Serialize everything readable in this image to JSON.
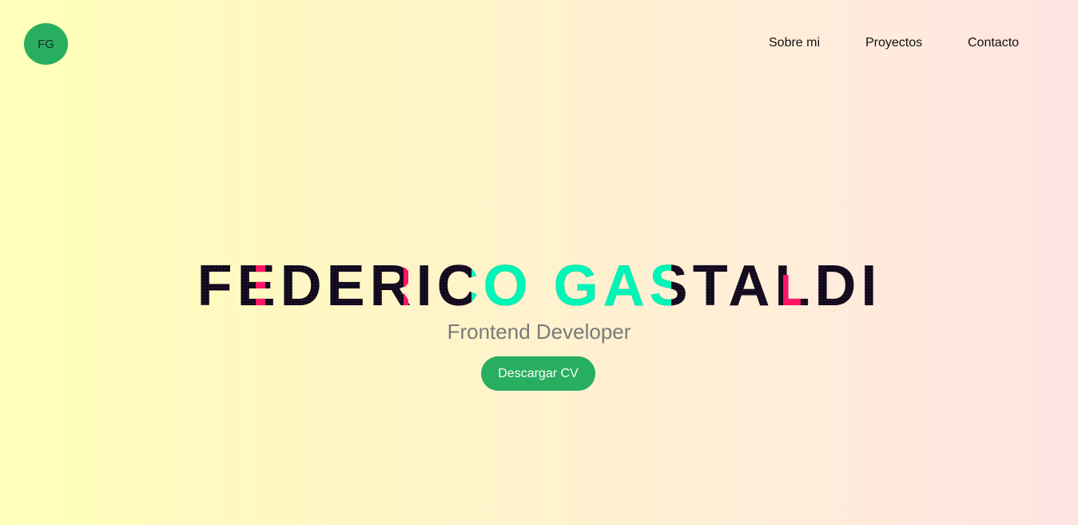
{
  "logo": {
    "initials": "FG"
  },
  "nav": {
    "items": [
      {
        "label": "Sobre mi"
      },
      {
        "label": "Proyectos"
      },
      {
        "label": "Contacto"
      }
    ]
  },
  "hero": {
    "name": "FEDERICO GASTALDI",
    "subtitle": "Frontend Developer",
    "cta_label": "Descargar CV"
  },
  "colors": {
    "accent": "#27ae60",
    "title_dark": "#12081c",
    "glitch_cyan": "#00f5b8",
    "glitch_pink": "#ff1466",
    "subtitle": "#7a7a7a"
  }
}
